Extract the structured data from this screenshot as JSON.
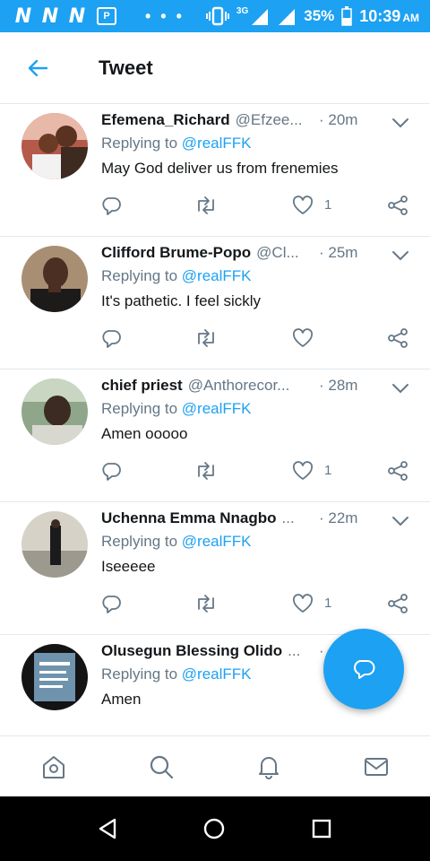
{
  "status_bar": {
    "notif_icons": [
      "N",
      "N",
      "N"
    ],
    "pay_icon_label": "P",
    "more_dots": "• • •",
    "network": "3G",
    "battery": "35%",
    "time": "10:39",
    "ampm": "AM"
  },
  "header": {
    "title": "Tweet"
  },
  "tweets": [
    {
      "name": "Efemena_Richard",
      "handle": "@Efzee...",
      "time": "· 20m",
      "replying_label": "Replying to ",
      "replying_to": "@realFFK",
      "text": "May God deliver us from frenemies",
      "likes": "1"
    },
    {
      "name": "Clifford Brume-Popo",
      "handle": "@Cl...",
      "time": "· 25m",
      "replying_label": "Replying to ",
      "replying_to": "@realFFK",
      "text": "It's pathetic. I feel sickly",
      "likes": ""
    },
    {
      "name": "chief priest",
      "handle": "@Anthorecor...",
      "time": "· 28m",
      "replying_label": "Replying to ",
      "replying_to": "@realFFK",
      "text": "Amen ooooo",
      "likes": "1"
    },
    {
      "name": "Uchenna Emma Nnagbo",
      "handle": "...",
      "time": "· 22m",
      "replying_label": "Replying to ",
      "replying_to": "@realFFK",
      "text": "Iseeeee",
      "likes": "1"
    },
    {
      "name": "Olusegun Blessing Olido",
      "handle": "...",
      "time": "·",
      "replying_label": "Replying to ",
      "replying_to": "@realFFK",
      "text": "Amen",
      "likes": ""
    }
  ],
  "icons": {
    "back": "arrow-left-icon",
    "reply": "reply-icon",
    "retweet": "retweet-icon",
    "like": "heart-icon",
    "share": "share-icon",
    "more": "chevron-down-icon",
    "compose_reply": "compose-reply-icon",
    "home": "home-icon",
    "search": "search-icon",
    "notifications": "bell-icon",
    "messages": "mail-icon"
  },
  "colors": {
    "accent": "#1da1f2",
    "text_primary": "#14171a",
    "text_secondary": "#657786"
  }
}
